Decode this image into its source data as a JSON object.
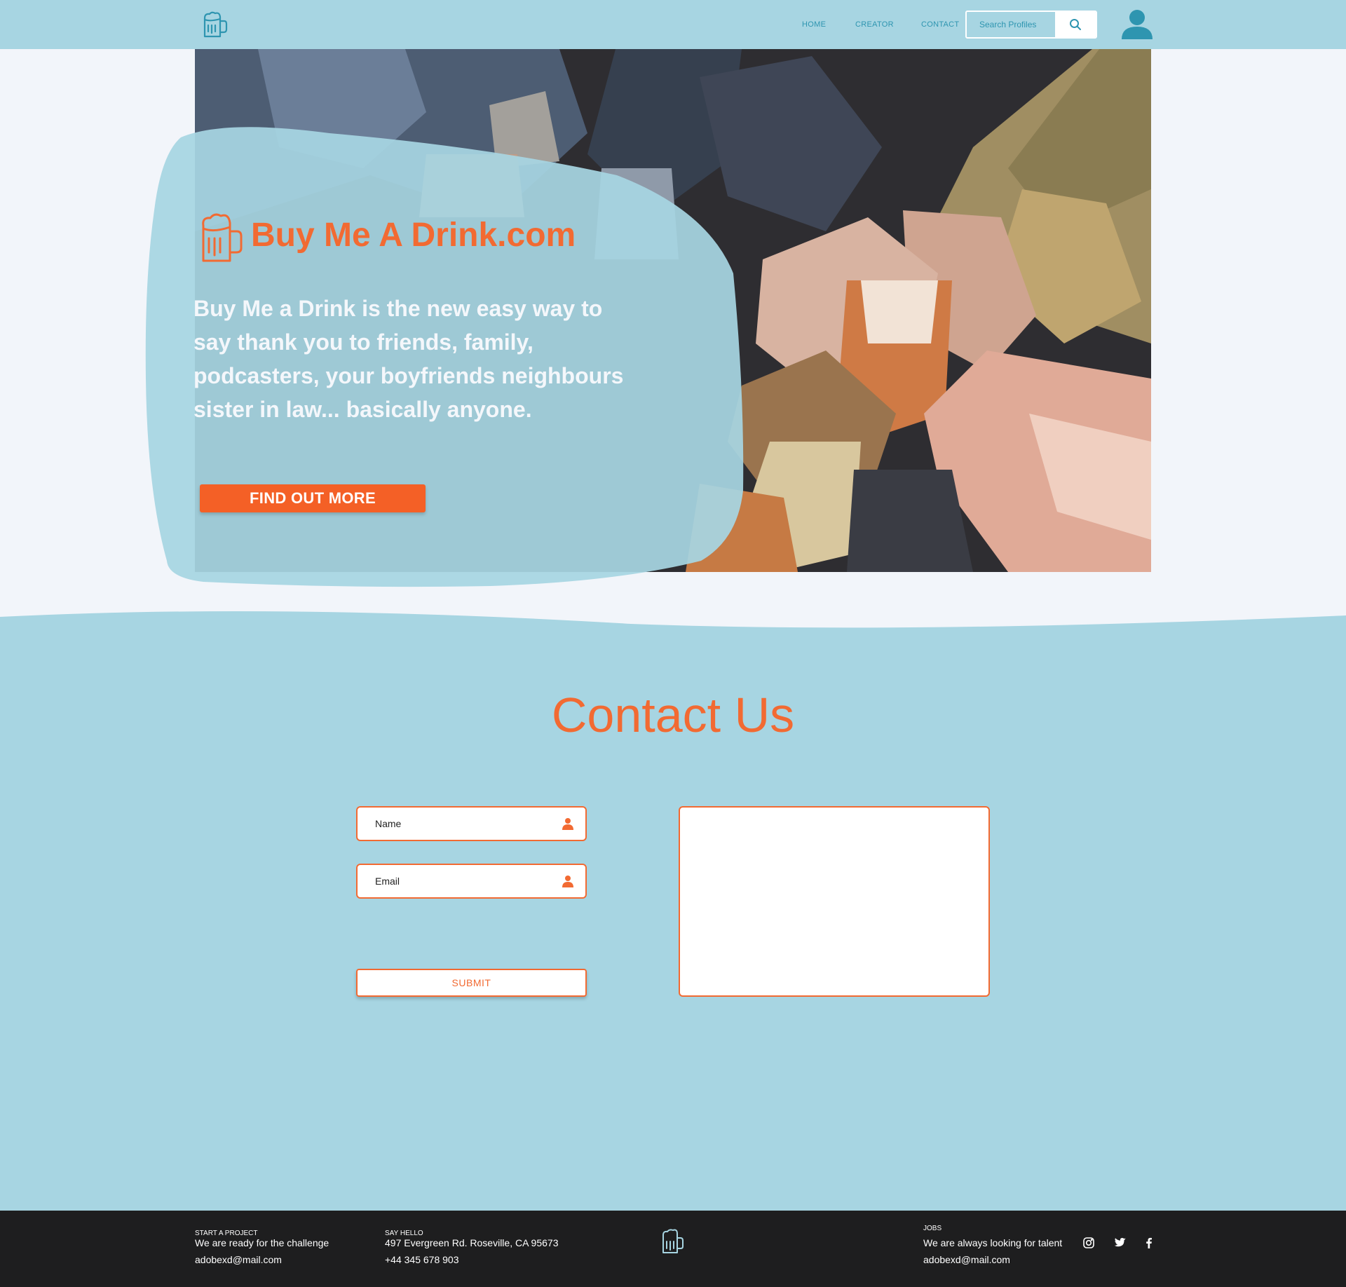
{
  "nav": {
    "links": [
      "HOME",
      "CREATOR",
      "CONTACT"
    ],
    "search_placeholder": "Search Profiles"
  },
  "hero": {
    "title": "Buy Me A Drink.com",
    "text": "Buy Me a Drink is the new easy way to say thank you to friends, family, podcasters, your boyfriends neighbours sister in law... basically anyone.",
    "cta": "FIND OUT MORE"
  },
  "contact": {
    "title": "Contact Us",
    "name_placeholder": "Name",
    "email_placeholder": "Email",
    "message_value": "",
    "submit": "SUBMIT"
  },
  "footer": {
    "col1": {
      "label": "START A PROJECT",
      "line1": "We are ready for the challenge",
      "line2": "adobexd@mail.com"
    },
    "col2": {
      "label": "SAY HELLO",
      "line1": "497 Evergreen Rd. Roseville, CA 95673",
      "line2": "+44 345 678 903"
    },
    "col3": {
      "label": "JOBS",
      "line1": "We are always looking for talent",
      "line2": "adobexd@mail.com"
    },
    "social": [
      "instagram-icon",
      "twitter-icon",
      "facebook-icon"
    ]
  },
  "colors": {
    "header_bg": "#a7d5e2",
    "page_bg": "#f2f5fa",
    "accent_orange": "#f26a32",
    "button_orange": "#f46026",
    "nav_blue": "#2e95b0",
    "footer_bg": "#1e1e1f"
  }
}
